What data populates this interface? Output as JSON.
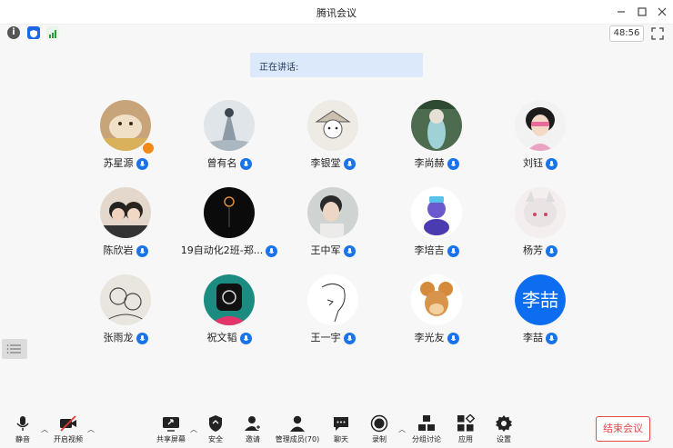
{
  "window": {
    "title": "腾讯会议"
  },
  "infobar": {
    "timer": "48:56"
  },
  "speaking": {
    "label": "正在讲话:"
  },
  "participants": [
    {
      "name": "苏星源",
      "avatar": "cat-photo"
    },
    {
      "name": "曾有名",
      "avatar": "ink-painting"
    },
    {
      "name": "李银堂",
      "avatar": "cartoon-hat"
    },
    {
      "name": "李尚赫",
      "avatar": "doll-photo"
    },
    {
      "name": "刘钰",
      "avatar": "girl-photo"
    },
    {
      "name": "陈欣岩",
      "avatar": "couple-photo"
    },
    {
      "name": "19自动化2班-郑...",
      "avatar": "dark-lamp"
    },
    {
      "name": "王中军",
      "avatar": "boy-photo"
    },
    {
      "name": "李培吉",
      "avatar": "cartoon-character"
    },
    {
      "name": "杨芳",
      "avatar": "anime-cat"
    },
    {
      "name": "张雨龙",
      "avatar": "sketch-cats"
    },
    {
      "name": "祝文韬",
      "avatar": "squid-game-guard"
    },
    {
      "name": "王一宇",
      "avatar": "line-sketch"
    },
    {
      "name": "李光友",
      "avatar": "jerry-mouse"
    },
    {
      "name": "李喆",
      "avatar": "text",
      "avatar_text": "李喆"
    }
  ],
  "toolbar": {
    "mute": "静音",
    "video": "开启视频",
    "share": "共享屏幕",
    "security": "安全",
    "invite": "邀请",
    "members": "管理成员(70)",
    "chat": "聊天",
    "record": "录制",
    "breakout": "分组讨论",
    "apps": "应用",
    "settings": "设置",
    "end": "结束会议"
  },
  "colors": {
    "accent": "#1a73e8",
    "end": "#e24b4b",
    "speaking_bg": "#dbe9fb"
  }
}
